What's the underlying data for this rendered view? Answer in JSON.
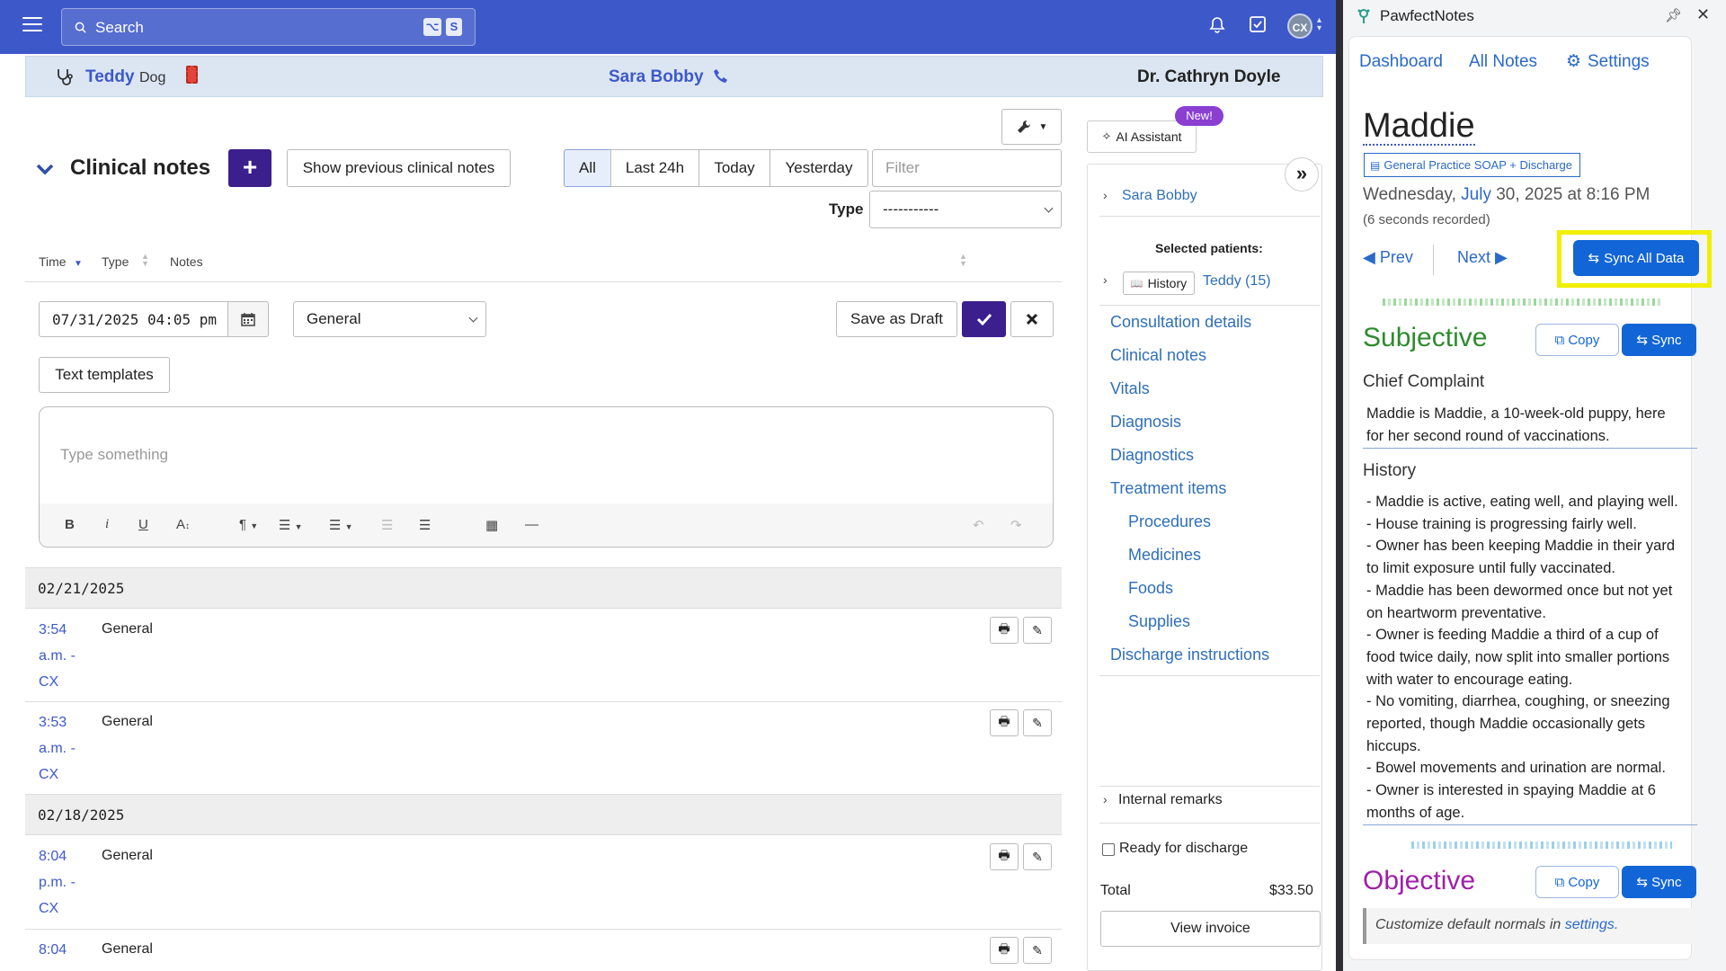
{
  "topbar": {
    "search_placeholder": "Search",
    "kbd1": "⌥",
    "kbd2": "S",
    "avatar": "CX"
  },
  "patient": {
    "name": "Teddy",
    "species": "Dog",
    "owner": "Sara Bobby",
    "doctor": "Dr. Cathryn Doyle"
  },
  "clinical": {
    "title": "Clinical notes",
    "add_label": "+",
    "show_prev": "Show previous clinical notes",
    "filters": [
      "All",
      "Last 24h",
      "Today",
      "Yesterday"
    ],
    "filter_placeholder": "Filter",
    "type_label": "Type",
    "type_value": "-----------",
    "columns": {
      "time": "Time",
      "type": "Type",
      "notes": "Notes"
    },
    "editor": {
      "datetime": "07/31/2025 04:05 pm",
      "note_type": "General",
      "save_draft": "Save as Draft",
      "text_templates": "Text templates",
      "placeholder": "Type something"
    },
    "groups": [
      {
        "date": "02/21/2025",
        "entries": [
          {
            "time_lines": [
              "3:54",
              "a.m. -",
              "CX"
            ],
            "type": "General"
          },
          {
            "time_lines": [
              "3:53",
              "a.m. -",
              "CX"
            ],
            "type": "General"
          }
        ]
      },
      {
        "date": "02/18/2025",
        "entries": [
          {
            "time_lines": [
              "8:04",
              "p.m. -",
              "CX"
            ],
            "type": "General"
          },
          {
            "time_lines": [
              "8:04"
            ],
            "type": "General"
          }
        ]
      }
    ]
  },
  "right_pane": {
    "ai_assistant": "AI Assistant",
    "new_badge": "New!",
    "owner_link": "Sara Bobby",
    "selected_label": "Selected patients:",
    "history_btn": "History",
    "patient_link": "Teddy (15)",
    "sections": [
      "Consultation details",
      "Clinical notes",
      "Vitals",
      "Diagnosis",
      "Diagnostics",
      "Treatment items"
    ],
    "sub_sections": [
      "Procedures",
      "Medicines",
      "Foods",
      "Supplies"
    ],
    "discharge": "Discharge instructions",
    "internal_remarks": "Internal remarks",
    "ready_discharge": "Ready for discharge",
    "total_label": "Total",
    "total_value": "$33.50",
    "view_invoice": "View invoice"
  },
  "pawfect": {
    "app_title": "PawfectNotes",
    "nav": {
      "dashboard": "Dashboard",
      "all_notes": "All Notes",
      "settings": "Settings"
    },
    "patient_name": "Maddie",
    "template_tag": "General Practice SOAP + Discharge",
    "date_pre": "Wednesday,",
    "date_month": "July",
    "date_post": "30, 2025 at 8:16 PM",
    "recorded": "(6 seconds recorded)",
    "prev": "Prev",
    "next": "Next",
    "sync_all": "Sync All Data",
    "subjective": {
      "title": "Subjective",
      "copy": "Copy",
      "sync": "Sync",
      "chief_label": "Chief Complaint",
      "chief_lines": [
        "Maddie is Maddie, a 10-week-old puppy, here",
        "for her second round of vaccinations."
      ],
      "history_label": "History",
      "history_lines": [
        "- Maddie is active, eating well, and playing well.",
        "- House training is progressing fairly well.",
        "- Owner has been keeping Maddie in their yard",
        "to limit exposure until fully vaccinated.",
        "- Maddie has been dewormed once but not yet",
        "on heartworm preventative.",
        "- Owner is feeding Maddie a third of a cup of",
        "food twice daily, now split into smaller portions",
        "with water to encourage eating.",
        "- No vomiting, diarrhea, coughing, or sneezing",
        "reported, though Maddie occasionally gets",
        "hiccups.",
        "- Bowel movements and urination are normal.",
        "- Owner is interested in spaying Maddie at 6",
        "months of age."
      ]
    },
    "objective": {
      "title": "Objective",
      "copy": "Copy",
      "sync": "Sync",
      "hint_pre": "Customize default normals in",
      "hint_link": "settings."
    },
    "colors": {
      "subjective": "#2e8b2e",
      "objective": "#a01fa8",
      "highlight": "#f2ee00",
      "brand": "#3d59c9"
    }
  }
}
